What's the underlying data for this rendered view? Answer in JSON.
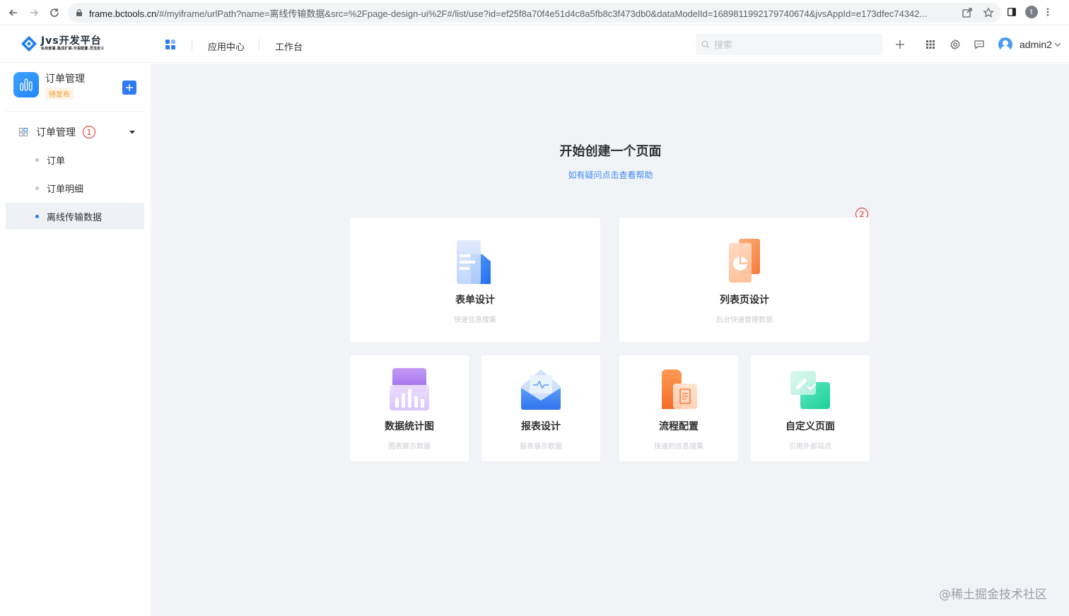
{
  "browser": {
    "url_host": "frame.bctools.cn",
    "url_path": "/#/myiframe/urlPath?name=离线传输数据&src=%2Fpage-design-ui%2F#/list/use?id=ef25f8a70f4e51d4c8a5fb8c3f473db0&dataModelId=1689811992179740674&jvsAppId=e173dfec74342...",
    "profile_initial": "t"
  },
  "header": {
    "logo_title": "Jvs开发平台",
    "logo_subtitle": "私有部署.集成扩展.可视配置.灵活定义",
    "nav": [
      "应用中心",
      "工作台"
    ],
    "search_placeholder": "搜索",
    "user_name": "admin2"
  },
  "sidebar": {
    "app_name": "订单管理",
    "app_status": "待发布",
    "group_label": "订单管理",
    "group_badge": "1",
    "items": [
      {
        "label": "订单",
        "active": false
      },
      {
        "label": "订单明细",
        "active": false
      },
      {
        "label": "离线传输数据",
        "active": true
      }
    ]
  },
  "main": {
    "title": "开始创建一个页面",
    "help_link": "如有疑问点击查看帮助",
    "badge_2": "2",
    "cards": [
      {
        "title": "表单设计",
        "desc": "快速信息搜集",
        "icon": "form-design-icon"
      },
      {
        "title": "列表页设计",
        "desc": "后台快速管理数据",
        "icon": "list-page-icon"
      },
      {
        "title": "数据统计图",
        "desc": "图表展示数据",
        "icon": "chart-icon"
      },
      {
        "title": "报表设计",
        "desc": "报表展示数据",
        "icon": "report-icon"
      },
      {
        "title": "流程配置",
        "desc": "快速的信息搜集",
        "icon": "workflow-icon"
      },
      {
        "title": "自定义页面",
        "desc": "引用外部站点",
        "icon": "custom-page-icon"
      }
    ]
  },
  "watermark": "@稀土掘金技术社区",
  "colors": {
    "primary": "#2f7bf6",
    "badge_red": "#e0322a",
    "status_orange": "#f59a23"
  }
}
